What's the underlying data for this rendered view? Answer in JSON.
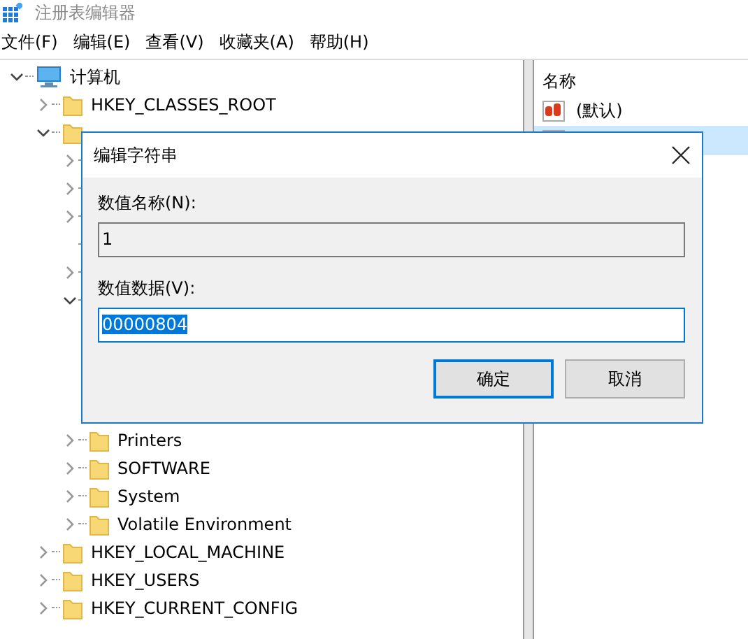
{
  "window": {
    "title": "注册表编辑器"
  },
  "menu": [
    "文件(F)",
    "编辑(E)",
    "查看(V)",
    "收藏夹(A)",
    "帮助(H)"
  ],
  "tree": [
    {
      "label": "计算机",
      "kind": "computer",
      "expanded": true,
      "children": [
        {
          "label": "HKEY_CLASSES_ROOT",
          "kind": "branch",
          "expanded": false
        },
        {
          "kind": "branch",
          "expanded": true,
          "children": [
            {
              "kind": "branch",
              "expanded": false
            },
            {
              "kind": "branch",
              "expanded": false
            },
            {
              "kind": "branch",
              "expanded": false
            },
            {
              "kind": "leaf"
            },
            {
              "kind": "branch",
              "expanded": false
            },
            {
              "kind": "branch",
              "expanded": true
            },
            {
              "label": "Printers",
              "kind": "branch",
              "expanded": false
            },
            {
              "label": "SOFTWARE",
              "kind": "branch",
              "expanded": false
            },
            {
              "label": "System",
              "kind": "branch",
              "expanded": false
            },
            {
              "label": "Volatile Environment",
              "kind": "branch",
              "expanded": false
            }
          ]
        },
        {
          "label": "HKEY_LOCAL_MACHINE",
          "kind": "branch",
          "expanded": false
        },
        {
          "label": "HKEY_USERS",
          "kind": "branch",
          "expanded": false
        },
        {
          "label": "HKEY_CURRENT_CONFIG",
          "kind": "branch",
          "expanded": false
        }
      ]
    }
  ],
  "values": {
    "column": "名称",
    "rows": [
      {
        "name": "(默认)",
        "selected": false
      },
      {
        "selected": true
      }
    ]
  },
  "dialog": {
    "title": "编辑字符串",
    "name_label": "数值名称(N):",
    "name_value": "1",
    "data_label": "数值数据(V):",
    "data_value": "00000804",
    "data_selected": true,
    "buttons": [
      {
        "label": "确定",
        "default": true
      },
      {
        "label": "取消",
        "default": false
      }
    ]
  }
}
